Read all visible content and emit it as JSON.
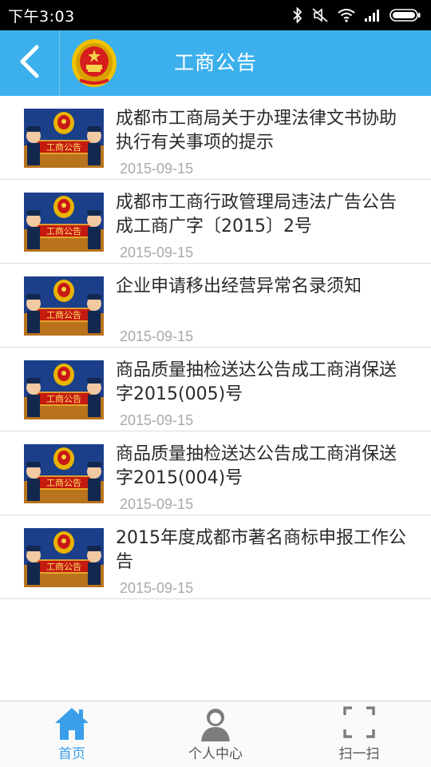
{
  "status_bar": {
    "time": "下午3:03",
    "icons": [
      "bluetooth-icon",
      "silent-icon",
      "wifi-icon",
      "signal-icon",
      "battery-icon"
    ]
  },
  "header": {
    "title": "工商公告",
    "back_icon": "chevron-left-icon",
    "logo_icon": "national-emblem-icon"
  },
  "notices": [
    {
      "title": "成都市工商局关于办理法律文书协助执行有关事项的提示",
      "date": "2015-09-15",
      "thumb_label": "工商公告"
    },
    {
      "title": "成都市工商行政管理局违法广告公告成工商广字〔2015〕2号",
      "date": "2015-09-15",
      "thumb_label": "工商公告"
    },
    {
      "title": "企业申请移出经营异常名录须知",
      "date": "2015-09-15",
      "thumb_label": "工商公告"
    },
    {
      "title": "商品质量抽检送达公告成工商消保送字2015(005)号",
      "date": "2015-09-15",
      "thumb_label": "工商公告"
    },
    {
      "title": "商品质量抽检送达公告成工商消保送字2015(004)号",
      "date": "2015-09-15",
      "thumb_label": "工商公告"
    },
    {
      "title": "2015年度成都市著名商标申报工作公告",
      "date": "2015-09-15",
      "thumb_label": "工商公告"
    }
  ],
  "bottom_nav": {
    "items": [
      {
        "label": "首页",
        "icon": "home-icon",
        "active": true
      },
      {
        "label": "个人中心",
        "icon": "user-icon",
        "active": false
      },
      {
        "label": "扫一扫",
        "icon": "scan-icon",
        "active": false
      }
    ]
  },
  "colors": {
    "header_bg": "#3cb0ec",
    "active_tab": "#3a9ee8",
    "date_text": "#a9a9a9"
  }
}
